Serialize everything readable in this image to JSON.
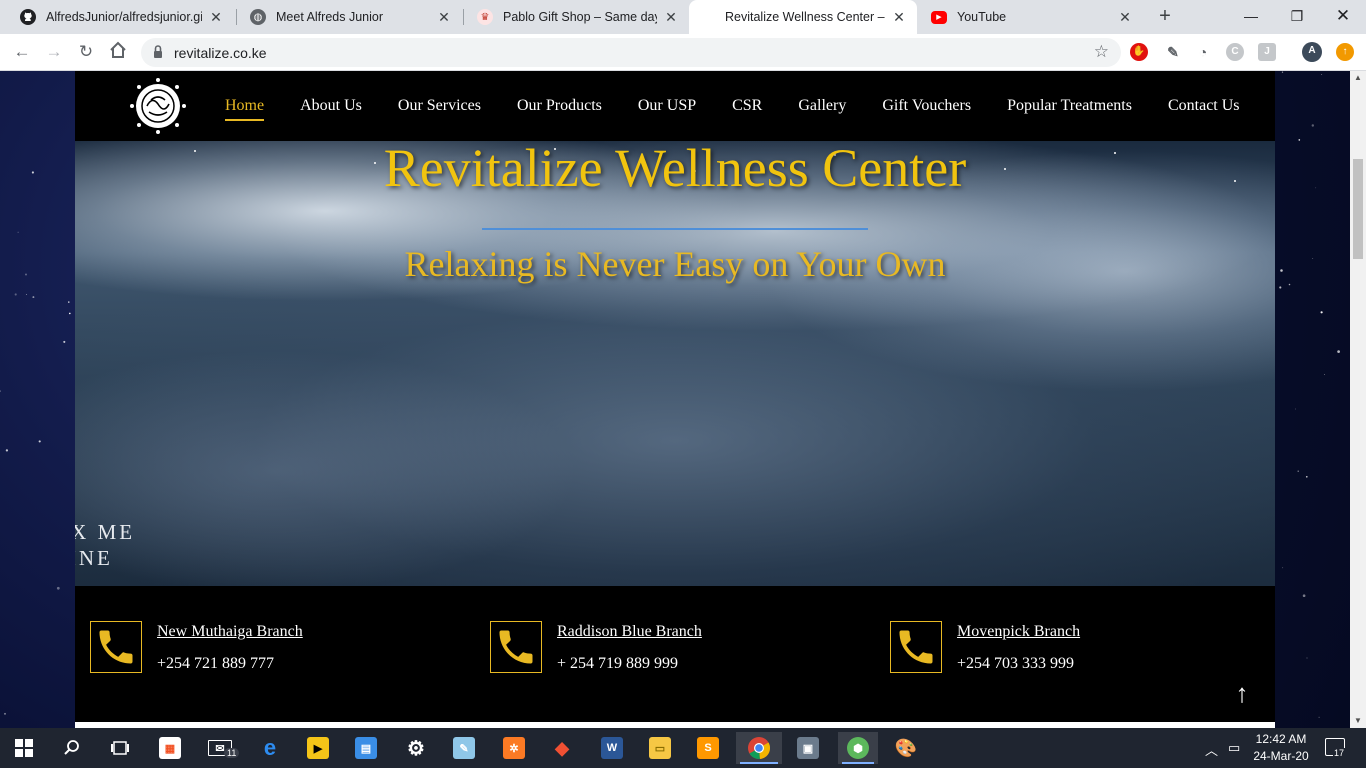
{
  "browser": {
    "tabs": [
      {
        "title": "AlfredsJunior/alfredsjunior.gith",
        "icon": "github-icon",
        "active": false
      },
      {
        "title": "Meet Alfreds Junior",
        "icon": "globe-icon",
        "active": false
      },
      {
        "title": "Pablo Gift Shop – Same day de",
        "icon": "gift-shop-icon",
        "active": false
      },
      {
        "title": "Revitalize Wellness Center – Sp",
        "icon": "none",
        "active": true
      },
      {
        "title": "YouTube",
        "icon": "youtube-icon",
        "active": false
      }
    ],
    "url": "revitalize.co.ke",
    "profile_initial": "A"
  },
  "site": {
    "nav": [
      {
        "label": "Home",
        "active": true
      },
      {
        "label": "About Us",
        "active": false
      },
      {
        "label": "Our Services",
        "active": false
      },
      {
        "label": "Our Products",
        "active": false
      },
      {
        "label": "Our USP",
        "active": false
      },
      {
        "label": "CSR",
        "active": false
      },
      {
        "label": "Gallery",
        "active": false
      },
      {
        "label": "Gift Vouchers",
        "active": false
      },
      {
        "label": "Popular Treatments",
        "active": false
      },
      {
        "label": "Contact Us",
        "active": false
      }
    ],
    "hero": {
      "title": "Revitalize Wellness Center",
      "subtitle": "Relaxing is Never Easy on Your Own",
      "overlay_line1": "AX ME",
      "overlay_line2": "LINE"
    },
    "branches": [
      {
        "name": "New Muthaiga Branch",
        "phone": "+254 721 889 777"
      },
      {
        "name": "Raddison Blue Branch",
        "phone": "+ 254 719 889 999"
      },
      {
        "name": "Movenpick Branch",
        "phone": "+254 703 333 999"
      }
    ],
    "accent_color": "#e8b923",
    "header_color": "#000000"
  },
  "taskbar": {
    "mail_badge": "11",
    "clock_time": "12:42 AM",
    "clock_date": "24-Mar-20",
    "notification_count": "17"
  }
}
